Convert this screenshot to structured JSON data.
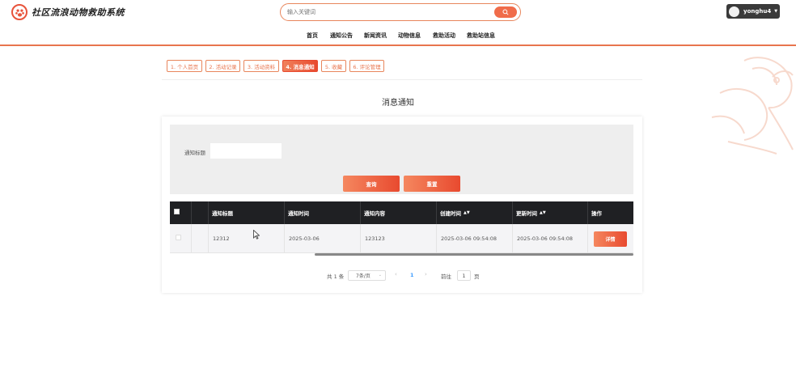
{
  "app": {
    "title": "社区流浪动物救助系统"
  },
  "search": {
    "placeholder": "输入关键词"
  },
  "user": {
    "name": "yonghu4"
  },
  "nav": [
    "首页",
    "通知公告",
    "新闻资讯",
    "动物信息",
    "救助活动",
    "救助站信息"
  ],
  "tabs": [
    "1. 个人首页",
    "2. 活动记录",
    "3. 活动资料",
    "4. 消息通知",
    "5. 收藏",
    "6. 评论管理"
  ],
  "active_tab_index": 3,
  "page": {
    "title": "消息通知"
  },
  "filter": {
    "label": "通知标题",
    "value": "",
    "query_label": "查询",
    "reset_label": "重置"
  },
  "table": {
    "columns": [
      "通知标题",
      "通知时间",
      "通知内容",
      "创建时间",
      "更新时间",
      "操作"
    ],
    "rows": [
      {
        "title": "12312",
        "time": "2025-03-06",
        "content": "123123",
        "created": "2025-03-06 09:54:08",
        "updated": "2025-03-06 09:54:08",
        "action": "详情"
      }
    ]
  },
  "pagination": {
    "total_text": "共 1 条",
    "page_size": "7条/页",
    "current_page": "1",
    "goto_label": "前往",
    "goto_value": "1",
    "page_unit": "页"
  }
}
